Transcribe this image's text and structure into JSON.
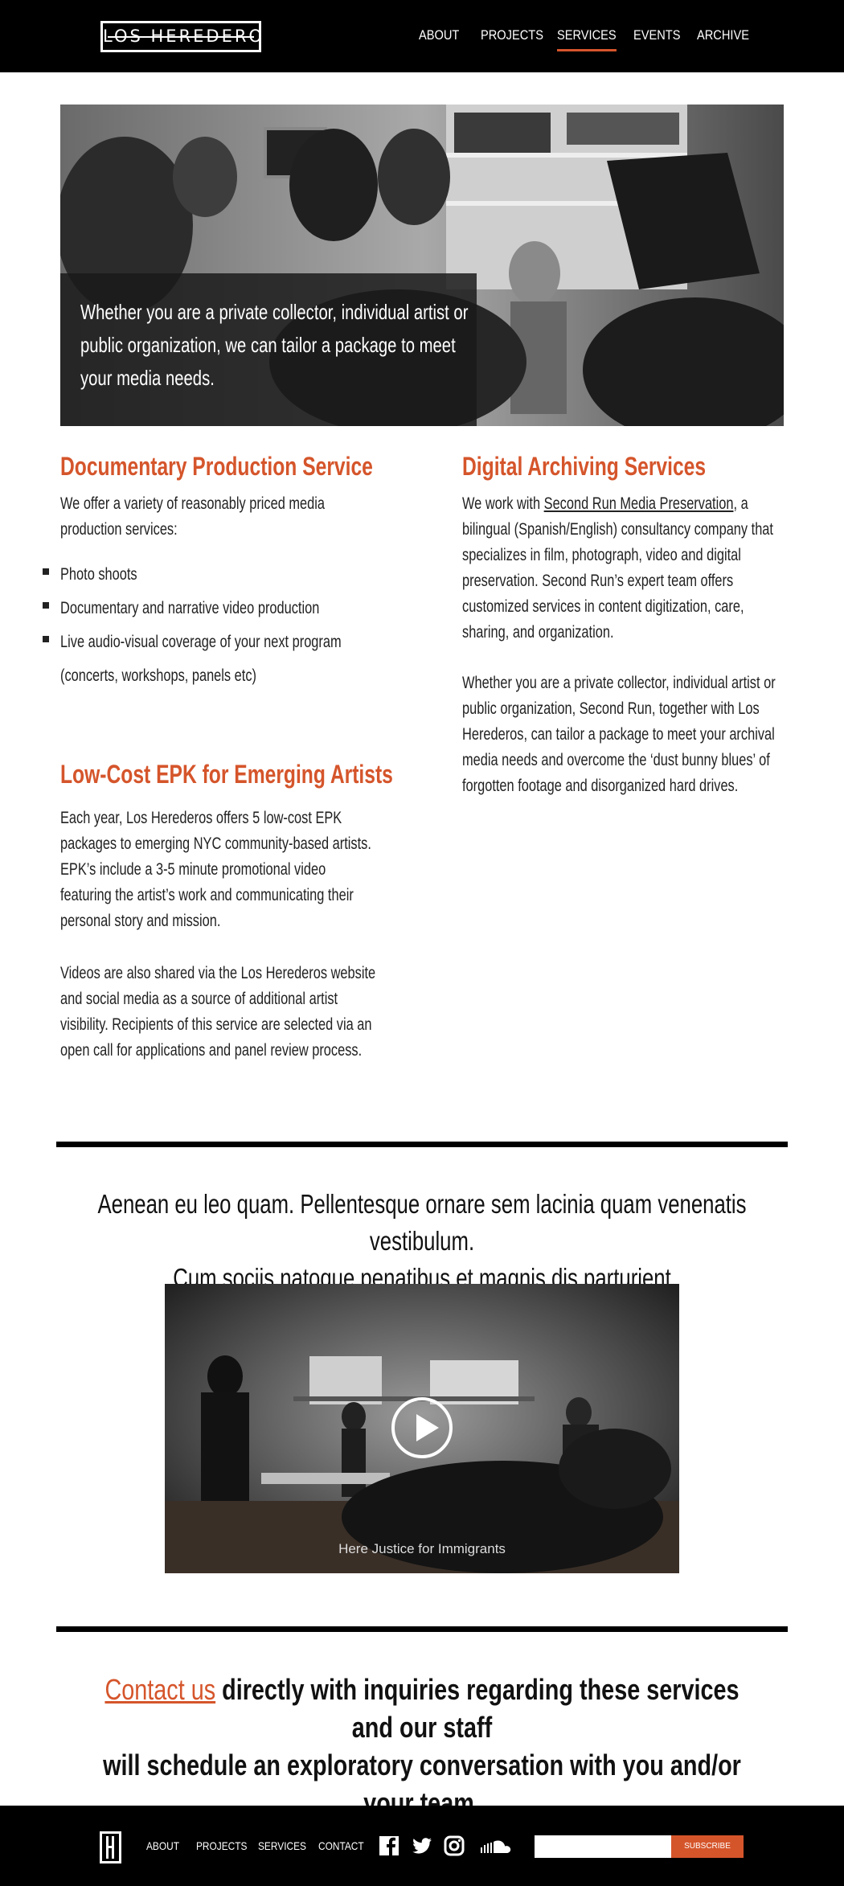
{
  "header": {
    "logo_text": "LOS HEREDEROS",
    "nav": [
      {
        "label": "ABOUT"
      },
      {
        "label": "PROJECTS"
      },
      {
        "label": "SERVICES",
        "active": true
      },
      {
        "label": "EVENTS"
      },
      {
        "label": "ARCHIVE"
      }
    ]
  },
  "hero": {
    "text": "Whether you are a private collector, individual artist or public organization, we can tailor a package to meet your  media needs."
  },
  "documentary": {
    "title": "Documentary Production Service",
    "intro": "We offer a variety of reasonably priced media production services:",
    "bullets": [
      "Photo shoots",
      "Documentary and narrative video production",
      "Live audio-visual coverage of your next program",
      "(concerts, workshops, panels etc)"
    ]
  },
  "epk": {
    "title": "Low-Cost EPK for Emerging Artists",
    "para1": "Each year, Los Herederos offers 5 low-cost EPK packages to emerging NYC community-based artists. EPK’s include a 3-5 minute promotional video featuring the artist’s work and communicating their personal story and mission.",
    "para2": "Videos are also shared via the Los Herederos website and social media as a source of additional artist visibility. Recipients of this service are selected via an open call for applications and panel review process."
  },
  "archiving": {
    "title": "Digital Archiving Services",
    "para1_prefix": "We work with ",
    "para1_link": "Second Run Media Preservation",
    "para1_suffix": ", a bilingual (Spanish/English) consultancy company that specializes in film, photograph, video and digital preservation. Second Run’s expert team offers customized services in content digitization, care, sharing, and organization.",
    "para2": "Whether you are a private collector, individual artist or public organization, Second Run, together with Los Herederos, can tailor a package to meet your archival media needs and overcome the ‘dust bunny blues’ of forgotten footage and disorganized hard drives."
  },
  "quote": {
    "line1": "Aenean eu leo quam. Pellentesque ornare sem lacinia quam venenatis vestibulum.",
    "line2": "Cum sociis natoque penatibus et magnis dis parturient"
  },
  "video": {
    "caption": "Here Justice for Immigrants"
  },
  "contact": {
    "link": "Contact us",
    "line1_rest": " directly with inquiries regarding these services and our staff",
    "line2": "will schedule an exploratory conversation with you and/or your team."
  },
  "footer": {
    "links": [
      "ABOUT",
      "PROJECTS",
      "SERVICES",
      "CONTACT"
    ],
    "social_icons": [
      "facebook-icon",
      "twitter-icon",
      "instagram-icon",
      "soundcloud-icon"
    ],
    "newsletter_placeholder": "",
    "subscribe_label": "SUBSCRIBE"
  },
  "colors": {
    "accent": "#d5552b",
    "header_bg": "#000000",
    "footer_bg": "#000000"
  }
}
